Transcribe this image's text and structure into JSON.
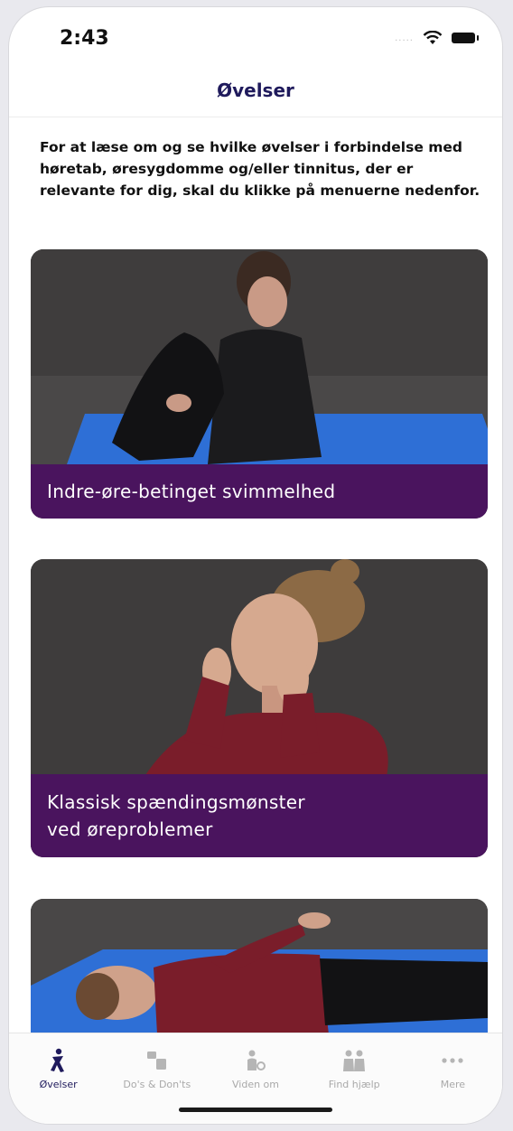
{
  "status_bar": {
    "time": "2:43",
    "signal": "....."
  },
  "nav": {
    "title": "Øvelser"
  },
  "intro_text": "For at læse om og se hvilke øvelser i forbindelse med høretab, øresygdomme og/eller tinnitus, der er relevante for dig, skal du klikke på menuerne nedenfor.",
  "cards": [
    {
      "caption": "Indre-øre-betinget svimmelhed"
    },
    {
      "caption_line1": "Klassisk spændingsmønster",
      "caption_line2": "ved øreproblemer"
    }
  ],
  "tabs": [
    {
      "label": "Øvelser",
      "icon": "exercise-icon"
    },
    {
      "label": "Do's & Don'ts",
      "icon": "dos-donts-icon"
    },
    {
      "label": "Viden om",
      "icon": "knowledge-icon"
    },
    {
      "label": "Find hjælp",
      "icon": "find-help-icon"
    },
    {
      "label": "Mere",
      "icon": "more-icon"
    }
  ],
  "colors": {
    "accent": "#4a145e",
    "title": "#1f1a5c",
    "mat": "#2e6fd6",
    "inactive_tab": "#a9a9a9"
  }
}
